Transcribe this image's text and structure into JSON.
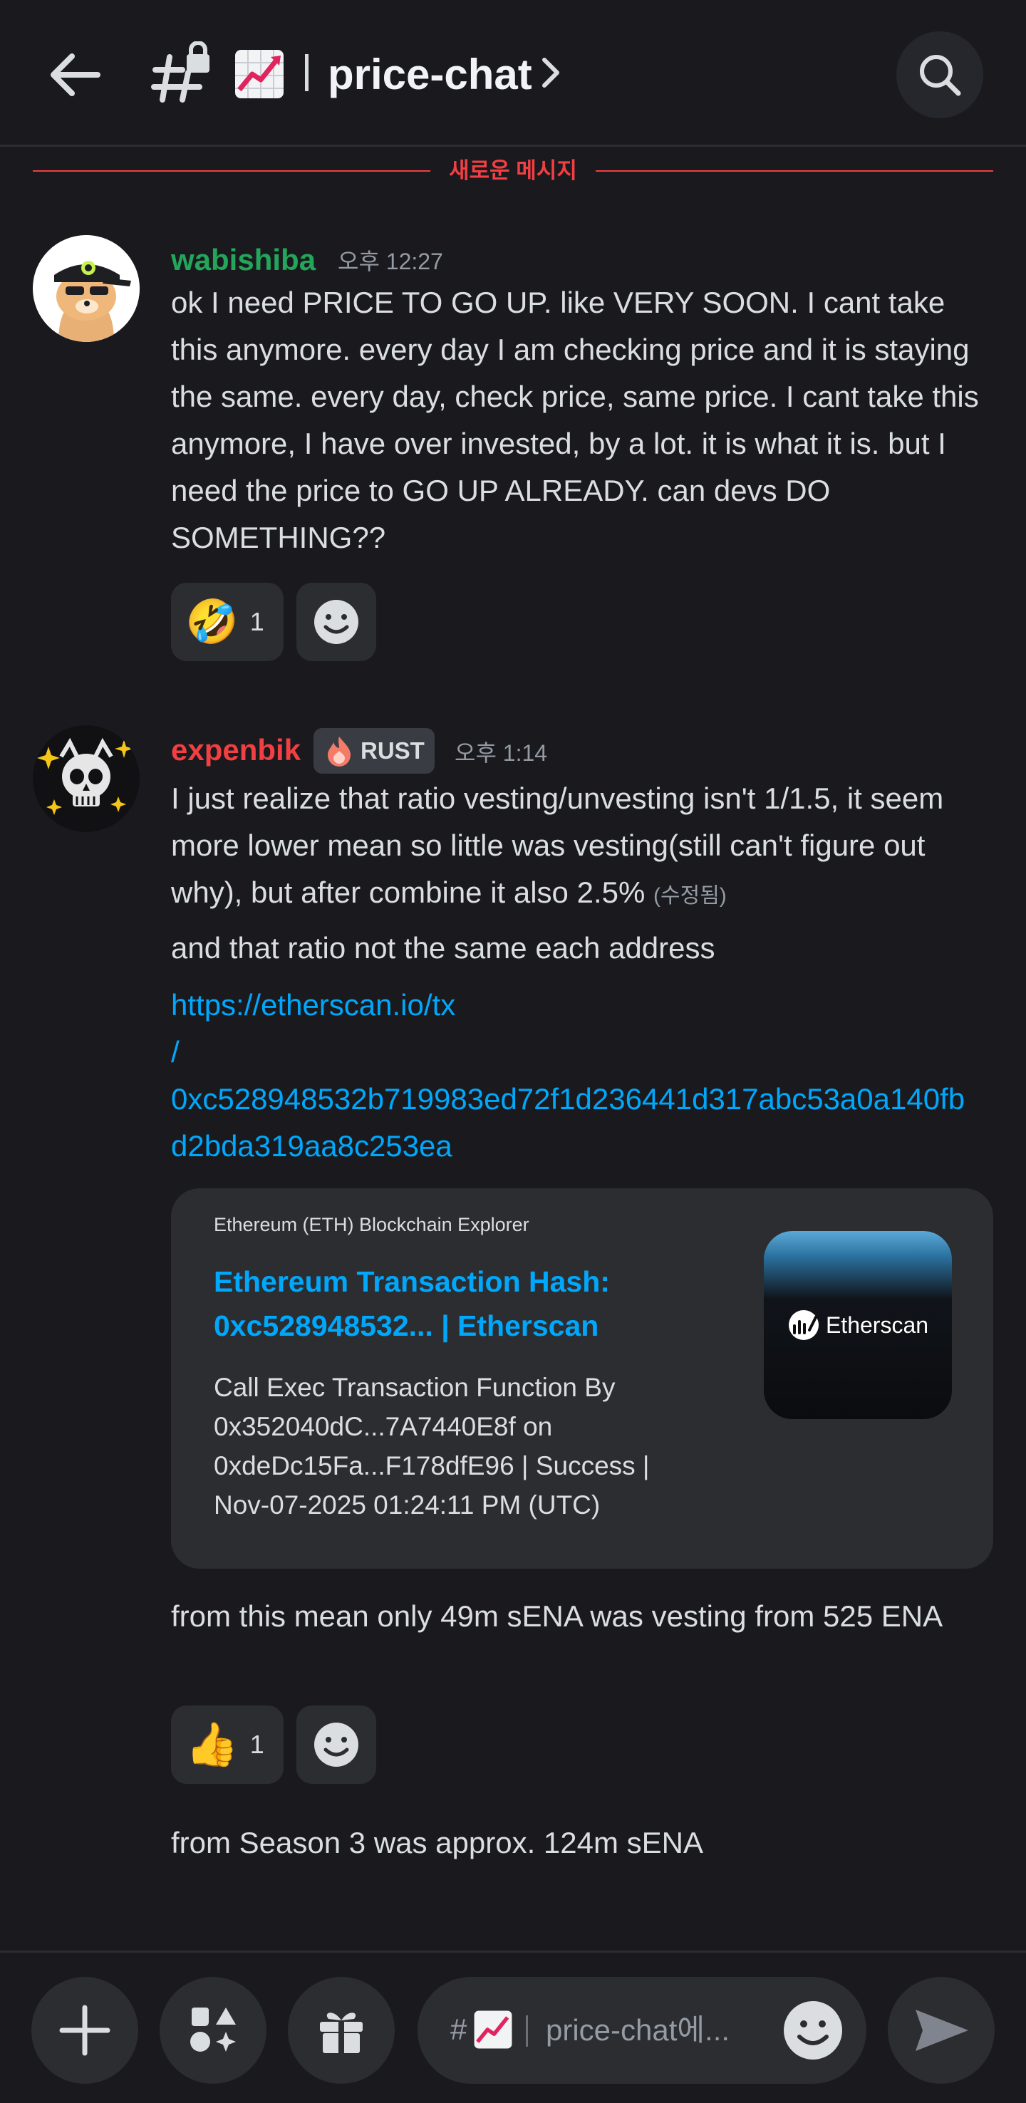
{
  "header": {
    "channel_name": "price-chat",
    "back_icon": "arrow-left-icon",
    "search_icon": "search-icon"
  },
  "new_messages_label": "새로운 메시지",
  "messages": [
    {
      "username": "wabishiba",
      "username_color": "#23a55a",
      "timestamp": "오후 12:27",
      "text": "ok I need PRICE TO GO UP. like VERY SOON. I cant take this anymore. every day I am checking price and it is staying the same. every day, check price, same price. I cant take this anymore, I have over invested, by a lot. it is what it is. but I need the price to GO UP ALREADY. can devs DO SOMETHING??",
      "reaction": {
        "emoji": "🤣",
        "count": "1"
      }
    },
    {
      "username": "expenbik",
      "username_color": "#f23f43",
      "role": "RUST",
      "timestamp": "오후 1:14",
      "text": "I just realize that ratio vesting/unvesting isn't 1/1.5, it seem more lower mean so little was vesting(still can't figure out why), but after combine it also 2.5%",
      "edited": "(수정됨)",
      "text2": "and that ratio not the same each address",
      "link": "https://etherscan.io/tx/0xc528948532b719983ed72f1d236441d317abc53a0a140fbd2bda319aa8c253ea",
      "link_lines": [
        "https://etherscan.io/tx",
        "/",
        "0xc528948532b719983ed72f1d236441d317abc53a0a140fb",
        "d2bda319aa8c253ea"
      ],
      "embed": {
        "provider": "Ethereum (ETH) Blockchain Explorer",
        "title": "Ethereum Transaction Hash: 0xc528948532... | Etherscan",
        "description": "Call Exec Transaction Function By 0x352040dC...7A7440E8f on 0xdeDc15Fa...F178dfE96 | Success | Nov-07-2025 01:24:11 PM (UTC)",
        "thumb_label": "Etherscan"
      },
      "text3": "from this mean only 49m sENA was vesting from 525 ENA",
      "reaction": {
        "emoji": "👍",
        "count": "1"
      },
      "text4": "from Season 3 was approx. 124m sENA"
    }
  ],
  "composer": {
    "placeholder": "price-chat에...",
    "hash": "#"
  }
}
